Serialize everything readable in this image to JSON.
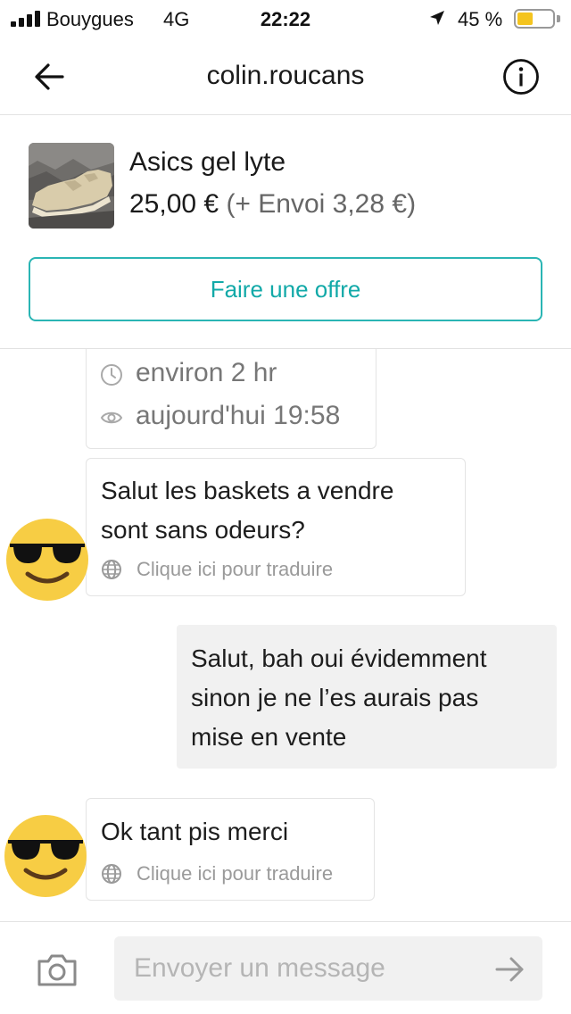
{
  "status_bar": {
    "carrier": "Bouygues",
    "network": "4G",
    "time": "22:22",
    "battery_percent": "45 %",
    "battery_level": 0.45,
    "icons": [
      "signal-icon",
      "location-arrow-icon",
      "battery-icon"
    ]
  },
  "header": {
    "title": "colin.roucans",
    "back_icon": "arrow-left-icon",
    "info_icon": "info-circle-icon"
  },
  "item": {
    "title": "Asics gel lyte",
    "price": "25,00 €",
    "shipping": "(+ Envoi 3,28 €)",
    "offer_button": "Faire une offre"
  },
  "conversation": {
    "meta": {
      "response_time": "environ 2 hr",
      "last_seen": "aujourd'hui 19:58",
      "icons": [
        "clock-icon",
        "eye-icon"
      ]
    },
    "messages": [
      {
        "sender": "other",
        "text_line1": "Salut les baskets a vendre",
        "text_line2": "sont sans odeurs?",
        "translate": "Clique ici pour traduire"
      },
      {
        "sender": "me",
        "text_line1": "Salut, bah oui évidemment",
        "text_line2": "sinon je ne l’es aurais pas",
        "text_line3": "mise en vente"
      },
      {
        "sender": "other",
        "text_line1": "Ok tant pis merci",
        "translate": "Clique ici pour traduire"
      }
    ],
    "avatar_icon": "sunglasses-emoji-icon"
  },
  "composer": {
    "placeholder": "Envoyer un message",
    "value": "",
    "camera_icon": "camera-icon",
    "send_icon": "arrow-right-icon"
  },
  "colors": {
    "accent": "#2ab5b4",
    "bubble_me": "#f1f1f1",
    "battery": "#f4c41f"
  }
}
